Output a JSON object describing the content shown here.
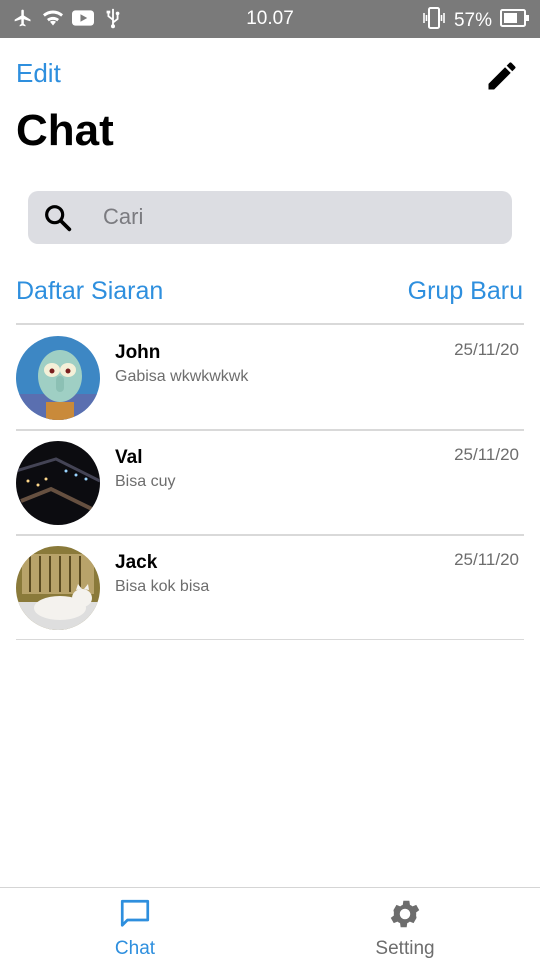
{
  "status_bar": {
    "time": "10.07",
    "battery": "57%",
    "icons": [
      "airplane-icon",
      "wifi-icon",
      "youtube-icon",
      "usb-icon",
      "vibrate-icon",
      "battery-icon"
    ]
  },
  "header": {
    "edit_label": "Edit",
    "title": "Chat",
    "compose_icon": "pencil-icon"
  },
  "search": {
    "placeholder": "Cari"
  },
  "links": {
    "broadcast": "Daftar Siaran",
    "new_group": "Grup Baru"
  },
  "chats": [
    {
      "name": "John",
      "message": "Gabisa wkwkwkwk",
      "date": "25/11/20"
    },
    {
      "name": "Val",
      "message": "Bisa cuy",
      "date": "25/11/20"
    },
    {
      "name": "Jack",
      "message": "Bisa kok bisa",
      "date": "25/11/20"
    }
  ],
  "bottom_nav": {
    "tabs": [
      {
        "label": "Chat",
        "icon": "chat-bubble-icon",
        "active": true
      },
      {
        "label": "Setting",
        "icon": "gear-icon",
        "active": false
      }
    ]
  },
  "colors": {
    "accent": "#2e8fde",
    "status_bar": "#7a7a7a",
    "search_bg": "#dcdde2",
    "inactive_tab": "#6d6d6d"
  }
}
